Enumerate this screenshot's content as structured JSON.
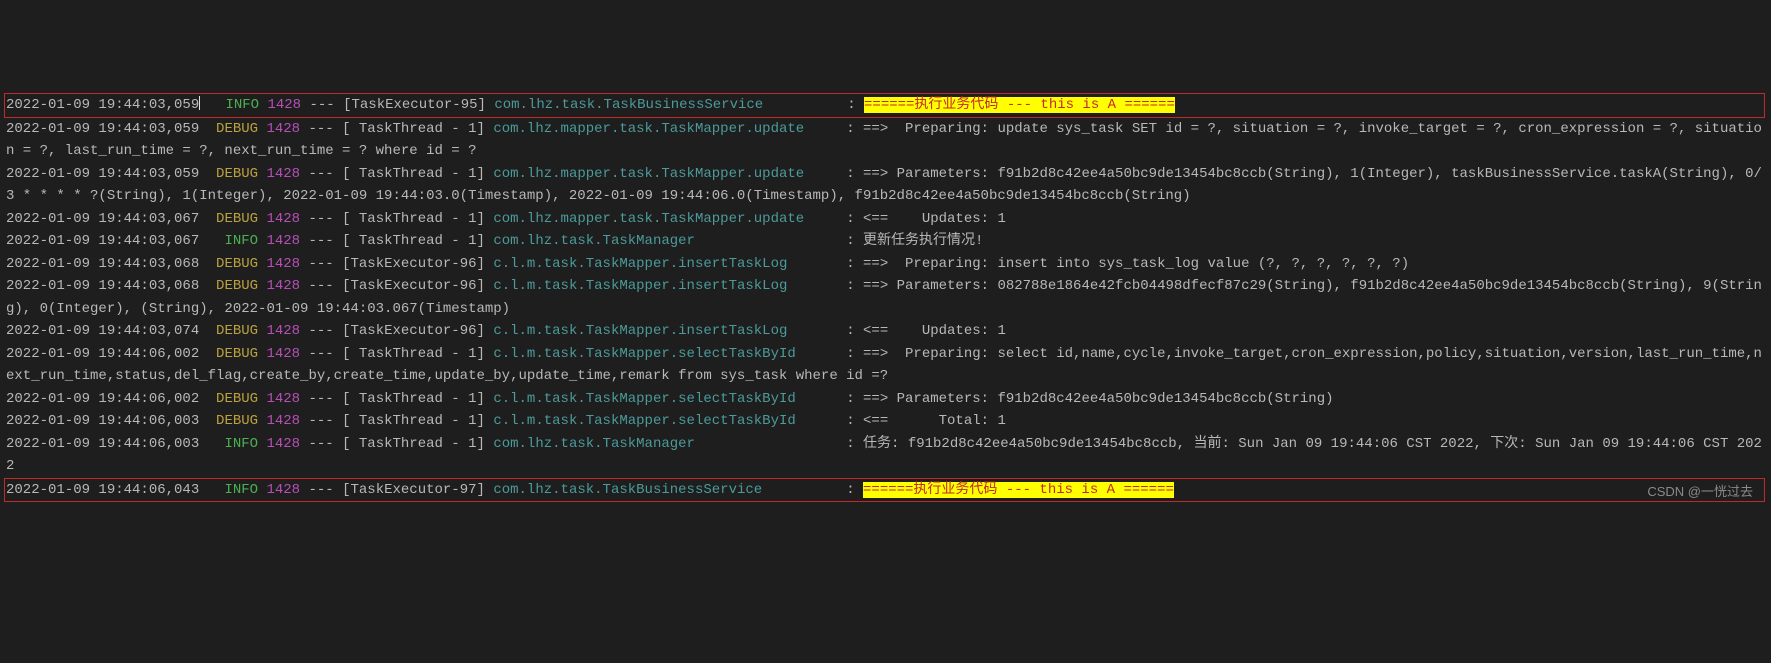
{
  "watermark": "CSDN @一恍过去",
  "lines": [
    {
      "hl": true,
      "ts": "2022-01-09 19:44:03,059",
      "cursor": true,
      "level": "INFO",
      "lvlClass": "lvl-info",
      "lvlPad": " INFO",
      "pid": "1428",
      "thread": "[TaskExecutor-95]",
      "logger": "com.lhz.task.TaskBusinessService         ",
      "msg": "======执行业务代码 --- this is A ======",
      "msgYellow": true,
      "cont": ""
    },
    {
      "hl": false,
      "ts": "2022-01-09 19:44:03,059",
      "level": "DEBUG",
      "lvlClass": "lvl-debug",
      "lvlPad": "DEBUG",
      "pid": "1428",
      "thread": "[ TaskThread - 1]",
      "logger": "com.lhz.mapper.task.TaskMapper.update    ",
      "msg": "==>  Preparing: update sys_task SET id = ?, situation = ?, invoke_target = ?, cron_expression = ?, situation = ?, last_run_time = ?, next_run_time = ? where id = ?",
      "msgYellow": false,
      "cont": ""
    },
    {
      "hl": false,
      "ts": "2022-01-09 19:44:03,059",
      "level": "DEBUG",
      "lvlClass": "lvl-debug",
      "lvlPad": "DEBUG",
      "pid": "1428",
      "thread": "[ TaskThread - 1]",
      "logger": "com.lhz.mapper.task.TaskMapper.update    ",
      "msg": "==> Parameters: f91b2d8c42ee4a50bc9de13454bc8ccb(String), 1(Integer), taskBusinessService.taskA(String), 0/3 * * * * ?(String), 1(Integer), 2022-01-09 19:44:03.0(Timestamp), 2022-01-09 19:44:06.0(Timestamp), f91b2d8c42ee4a50bc9de13454bc8ccb(String)",
      "msgYellow": false,
      "cont": ""
    },
    {
      "hl": false,
      "ts": "2022-01-09 19:44:03,067",
      "level": "DEBUG",
      "lvlClass": "lvl-debug",
      "lvlPad": "DEBUG",
      "pid": "1428",
      "thread": "[ TaskThread - 1]",
      "logger": "com.lhz.mapper.task.TaskMapper.update    ",
      "msg": "<==    Updates: 1",
      "msgYellow": false,
      "cont": ""
    },
    {
      "hl": false,
      "ts": "2022-01-09 19:44:03,067",
      "level": "INFO",
      "lvlClass": "lvl-info",
      "lvlPad": " INFO",
      "pid": "1428",
      "thread": "[ TaskThread - 1]",
      "logger": "com.lhz.task.TaskManager                 ",
      "msg": "更新任务执行情况!",
      "msgYellow": false,
      "cont": ""
    },
    {
      "hl": false,
      "ts": "2022-01-09 19:44:03,068",
      "level": "DEBUG",
      "lvlClass": "lvl-debug",
      "lvlPad": "DEBUG",
      "pid": "1428",
      "thread": "[TaskExecutor-96]",
      "logger": "c.l.m.task.TaskMapper.insertTaskLog      ",
      "msg": "==>  Preparing: insert into sys_task_log value (?, ?, ?, ?, ?, ?)",
      "msgYellow": false,
      "cont": ""
    },
    {
      "hl": false,
      "ts": "2022-01-09 19:44:03,068",
      "level": "DEBUG",
      "lvlClass": "lvl-debug",
      "lvlPad": "DEBUG",
      "pid": "1428",
      "thread": "[TaskExecutor-96]",
      "logger": "c.l.m.task.TaskMapper.insertTaskLog      ",
      "msg": "==> Parameters: 082788e1864e42fcb04498dfecf87c29(String), f91b2d8c42ee4a50bc9de13454bc8ccb(String), 9(String), 0(Integer), (String), 2022-01-09 19:44:03.067(Timestamp)",
      "msgYellow": false,
      "cont": ""
    },
    {
      "hl": false,
      "ts": "2022-01-09 19:44:03,074",
      "level": "DEBUG",
      "lvlClass": "lvl-debug",
      "lvlPad": "DEBUG",
      "pid": "1428",
      "thread": "[TaskExecutor-96]",
      "logger": "c.l.m.task.TaskMapper.insertTaskLog      ",
      "msg": "<==    Updates: 1",
      "msgYellow": false,
      "cont": ""
    },
    {
      "hl": false,
      "ts": "2022-01-09 19:44:06,002",
      "level": "DEBUG",
      "lvlClass": "lvl-debug",
      "lvlPad": "DEBUG",
      "pid": "1428",
      "thread": "[ TaskThread - 1]",
      "logger": "c.l.m.task.TaskMapper.selectTaskById     ",
      "msg": "==>  Preparing: select id,name,cycle,invoke_target,cron_expression,policy,situation,version,last_run_time,next_run_time,status,del_flag,create_by,create_time,update_by,update_time,remark from sys_task where id =?",
      "msgYellow": false,
      "cont": ""
    },
    {
      "hl": false,
      "ts": "2022-01-09 19:44:06,002",
      "level": "DEBUG",
      "lvlClass": "lvl-debug",
      "lvlPad": "DEBUG",
      "pid": "1428",
      "thread": "[ TaskThread - 1]",
      "logger": "c.l.m.task.TaskMapper.selectTaskById     ",
      "msg": "==> Parameters: f91b2d8c42ee4a50bc9de13454bc8ccb(String)",
      "msgYellow": false,
      "cont": ""
    },
    {
      "hl": false,
      "ts": "2022-01-09 19:44:06,003",
      "level": "DEBUG",
      "lvlClass": "lvl-debug",
      "lvlPad": "DEBUG",
      "pid": "1428",
      "thread": "[ TaskThread - 1]",
      "logger": "c.l.m.task.TaskMapper.selectTaskById     ",
      "msg": "<==      Total: 1",
      "msgYellow": false,
      "cont": ""
    },
    {
      "hl": false,
      "ts": "2022-01-09 19:44:06,003",
      "level": "INFO",
      "lvlClass": "lvl-info",
      "lvlPad": " INFO",
      "pid": "1428",
      "thread": "[ TaskThread - 1]",
      "logger": "com.lhz.task.TaskManager                 ",
      "msg": "任务: f91b2d8c42ee4a50bc9de13454bc8ccb, 当前: Sun Jan 09 19:44:06 CST 2022, 下次: Sun Jan 09 19:44:06 CST 2022",
      "msgYellow": false,
      "cont": ""
    },
    {
      "hl": true,
      "ts": "2022-01-09 19:44:06,043",
      "level": "INFO",
      "lvlClass": "lvl-info",
      "lvlPad": " INFO",
      "pid": "1428",
      "thread": "[TaskExecutor-97]",
      "logger": "com.lhz.task.TaskBusinessService         ",
      "msg": "======执行业务代码 --- this is A ======",
      "msgYellow": true,
      "cont": ""
    }
  ]
}
